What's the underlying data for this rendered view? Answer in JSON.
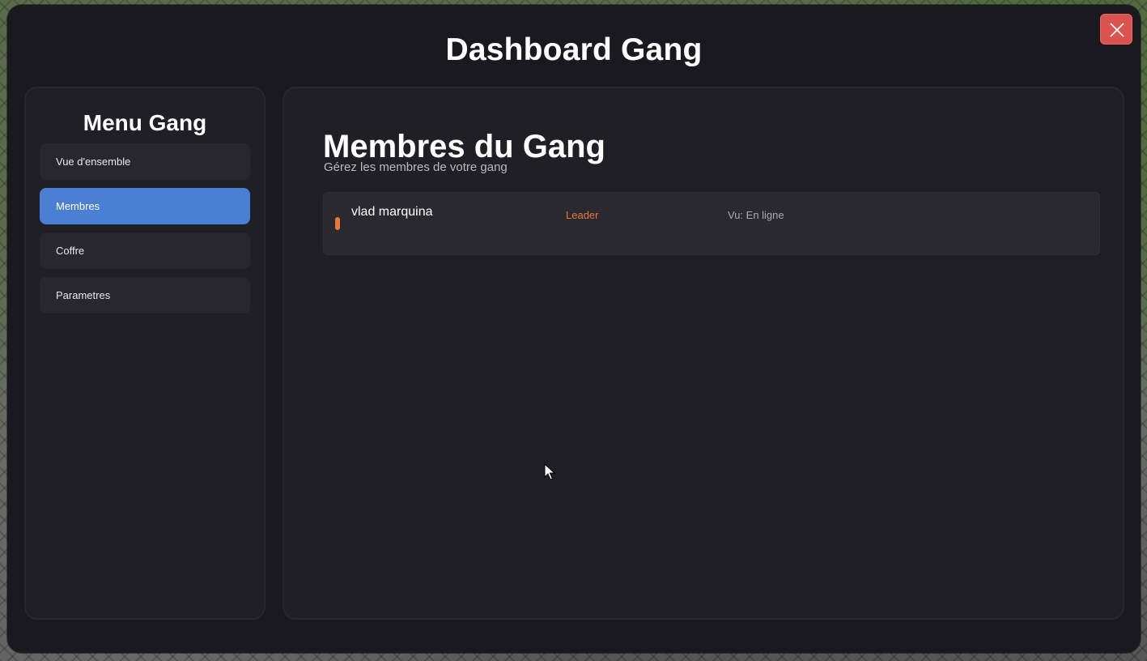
{
  "window": {
    "title": "Dashboard Gang"
  },
  "sidebar": {
    "title": "Menu Gang",
    "items": [
      {
        "label": "Vue d'ensemble"
      },
      {
        "label": "Membres",
        "active": true
      },
      {
        "label": "Coffre"
      },
      {
        "label": "Parametres"
      }
    ]
  },
  "main": {
    "title": "Membres du Gang",
    "subtitle": "Gérez les membres de votre gang",
    "members": [
      {
        "name": "vlad marquina",
        "role": "Leader",
        "seen": "Vu: En ligne",
        "status_color": "#e4783e"
      }
    ]
  },
  "icons": {
    "close": "close-icon",
    "cursor": "mouse-cursor-icon"
  },
  "colors": {
    "accent": "#4a7fd4",
    "close": "#d9534f",
    "leader": "#e4783e"
  }
}
